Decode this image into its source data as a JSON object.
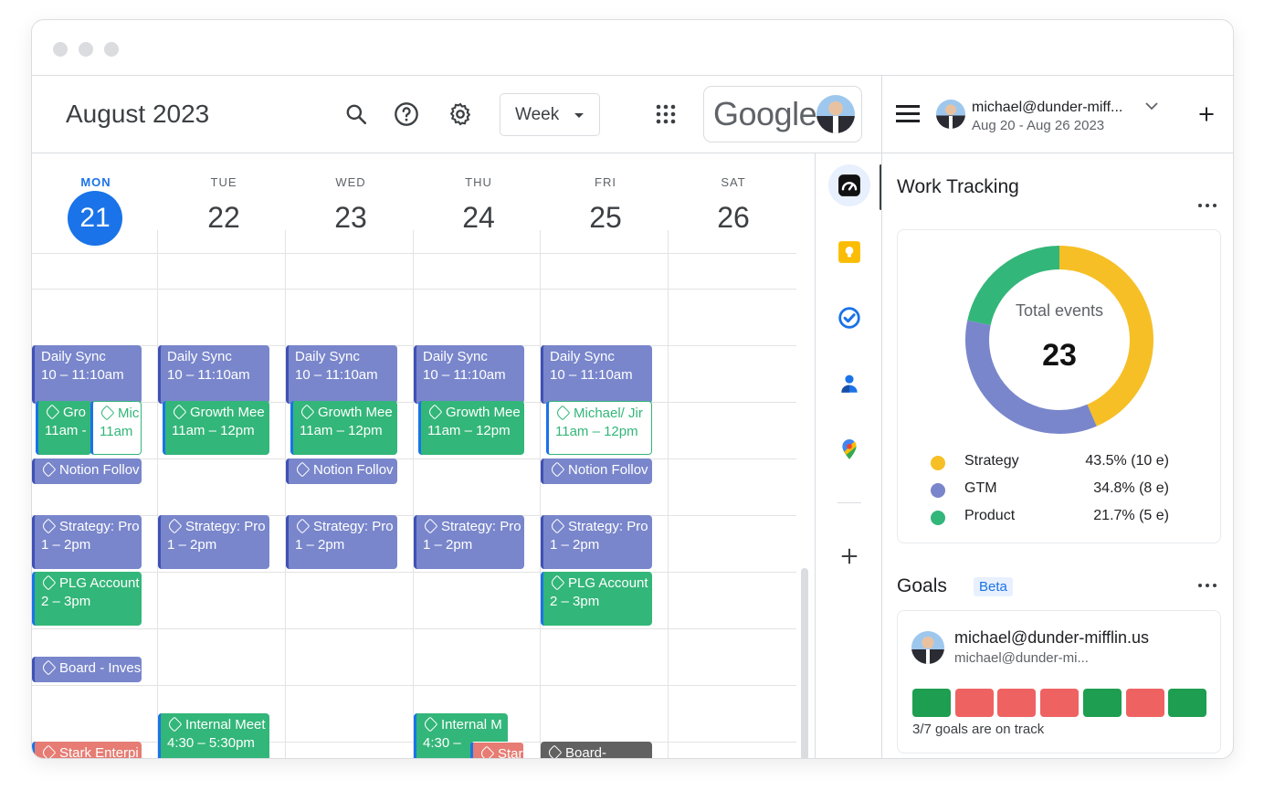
{
  "header": {
    "month_title": "August 2023",
    "view_label": "Week",
    "brand": "Google"
  },
  "days": [
    {
      "name": "MON",
      "num": "21",
      "today": true
    },
    {
      "name": "TUE",
      "num": "22"
    },
    {
      "name": "WED",
      "num": "23"
    },
    {
      "name": "THU",
      "num": "24"
    },
    {
      "name": "FRI",
      "num": "25"
    },
    {
      "name": "SAT",
      "num": "26"
    }
  ],
  "events": {
    "daily_sync": {
      "title": "Daily Sync",
      "time": "10 – 11:10am"
    },
    "growth_mon": {
      "title": "Gro",
      "time": "11am -"
    },
    "mic_mon": {
      "title": "Mic",
      "time": "11am"
    },
    "growth": {
      "title": "Growth Mee",
      "time": "11am – 12pm"
    },
    "michael_fri": {
      "title": "Michael/ Jir",
      "time": "11am – 12pm"
    },
    "notion": {
      "title": "Notion Follov"
    },
    "strategy": {
      "title": "Strategy: Pro",
      "time": "1 – 2pm"
    },
    "plg": {
      "title": "PLG Account",
      "time": "2 – 3pm"
    },
    "board_invest": {
      "title": "Board - Inves"
    },
    "internal_tue": {
      "title": "Internal Meet",
      "time": "4:30 – 5:30pm"
    },
    "internal_thu": {
      "title": "Internal M",
      "time": "4:30 –"
    },
    "stark_mon": {
      "title": "Stark Enterpi"
    },
    "stark_thu": {
      "title": "Star"
    },
    "board_fri": {
      "title": "Board-"
    }
  },
  "panel": {
    "account_email": "michael@dunder-miff...",
    "date_range": "Aug 20 - Aug 26 2023",
    "work_tracking": {
      "title": "Work Tracking",
      "center_label": "Total events",
      "total": "23",
      "legend": [
        {
          "label": "Strategy",
          "value": "43.5% (10 e)",
          "color": "#f6bf26"
        },
        {
          "label": "GTM",
          "value": "34.8% (8 e)",
          "color": "#7986cb"
        },
        {
          "label": "Product",
          "value": "21.7% (5 e)",
          "color": "#33b679"
        }
      ]
    },
    "goals": {
      "title": "Goals",
      "badge": "Beta",
      "email": "michael@dunder-mifflin.us",
      "sub_email": "michael@dunder-mi...",
      "status": [
        "green",
        "red",
        "red",
        "red",
        "green",
        "red",
        "green"
      ],
      "summary": "3/7 goals are on track"
    }
  },
  "chart_data": {
    "type": "pie",
    "categories": [
      "Strategy",
      "GTM",
      "Product"
    ],
    "values": [
      43.5,
      34.8,
      21.7
    ],
    "counts": [
      10,
      8,
      5
    ],
    "colors": [
      "#f6bf26",
      "#7986cb",
      "#33b679"
    ],
    "title": "Work Tracking"
  },
  "colors": {
    "accent": "#1a73e8",
    "green": "#1e9e50",
    "red": "#ef6262"
  }
}
